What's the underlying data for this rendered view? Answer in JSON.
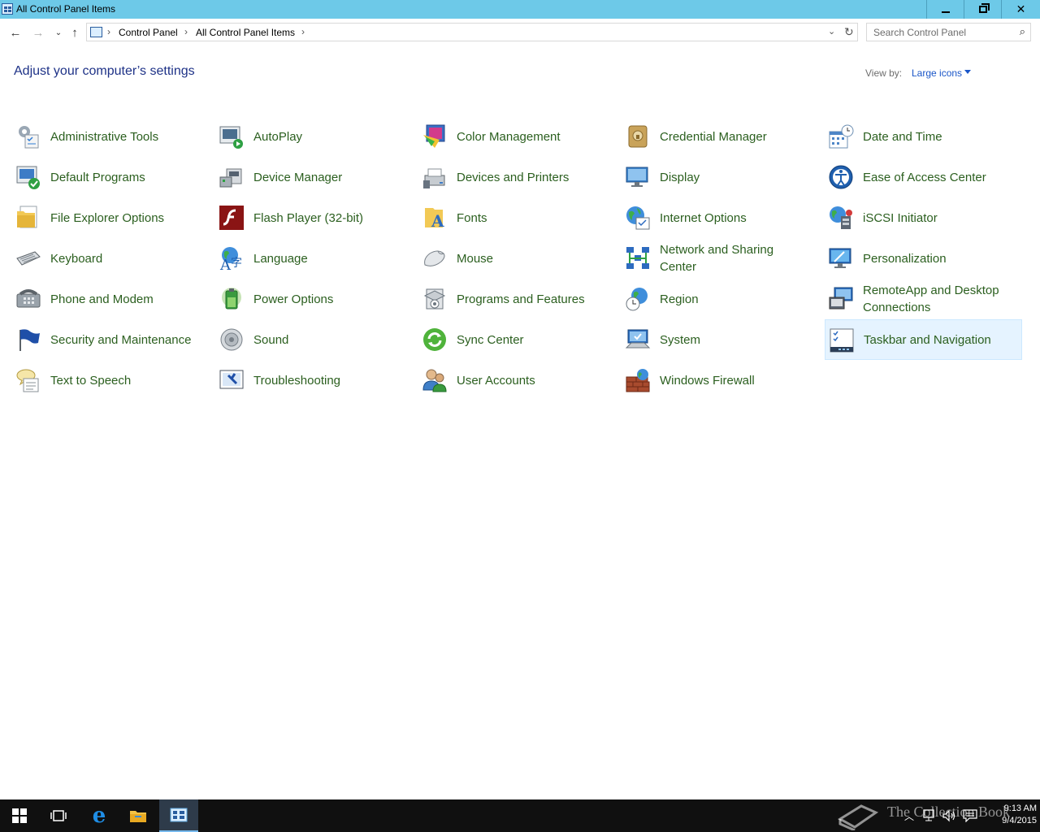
{
  "window": {
    "title": "All Control Panel Items"
  },
  "address": {
    "crumbs": [
      "Control Panel",
      "All Control Panel Items"
    ],
    "search_placeholder": "Search Control Panel"
  },
  "header": {
    "title": "Adjust your computer’s settings",
    "view_by_label": "View by:",
    "view_by_value": "Large icons"
  },
  "items": [
    {
      "label": "Administrative Tools",
      "icon": "administrative-tools-icon"
    },
    {
      "label": "AutoPlay",
      "icon": "autoplay-icon"
    },
    {
      "label": "Color Management",
      "icon": "color-management-icon"
    },
    {
      "label": "Credential Manager",
      "icon": "credential-manager-icon"
    },
    {
      "label": "Date and Time",
      "icon": "date-and-time-icon"
    },
    {
      "label": "Default Programs",
      "icon": "default-programs-icon"
    },
    {
      "label": "Device Manager",
      "icon": "device-manager-icon"
    },
    {
      "label": "Devices and Printers",
      "icon": "devices-and-printers-icon"
    },
    {
      "label": "Display",
      "icon": "display-icon"
    },
    {
      "label": "Ease of Access Center",
      "icon": "ease-of-access-icon"
    },
    {
      "label": "File Explorer Options",
      "icon": "file-explorer-options-icon"
    },
    {
      "label": "Flash Player (32-bit)",
      "icon": "flash-player-icon"
    },
    {
      "label": "Fonts",
      "icon": "fonts-icon"
    },
    {
      "label": "Internet Options",
      "icon": "internet-options-icon"
    },
    {
      "label": "iSCSI Initiator",
      "icon": "iscsi-initiator-icon"
    },
    {
      "label": "Keyboard",
      "icon": "keyboard-icon"
    },
    {
      "label": "Language",
      "icon": "language-icon"
    },
    {
      "label": "Mouse",
      "icon": "mouse-icon"
    },
    {
      "label": "Network and Sharing Center",
      "icon": "network-sharing-icon"
    },
    {
      "label": "Personalization",
      "icon": "personalization-icon"
    },
    {
      "label": "Phone and Modem",
      "icon": "phone-modem-icon"
    },
    {
      "label": "Power Options",
      "icon": "power-options-icon"
    },
    {
      "label": "Programs and Features",
      "icon": "programs-features-icon"
    },
    {
      "label": "Region",
      "icon": "region-icon"
    },
    {
      "label": "RemoteApp and Desktop Connections",
      "icon": "remoteapp-icon"
    },
    {
      "label": "Security and Maintenance",
      "icon": "security-maintenance-icon"
    },
    {
      "label": "Sound",
      "icon": "sound-icon"
    },
    {
      "label": "Sync Center",
      "icon": "sync-center-icon"
    },
    {
      "label": "System",
      "icon": "system-icon"
    },
    {
      "label": "Taskbar and Navigation",
      "icon": "taskbar-navigation-icon",
      "selected": true
    },
    {
      "label": "Text to Speech",
      "icon": "text-to-speech-icon"
    },
    {
      "label": "Troubleshooting",
      "icon": "troubleshooting-icon"
    },
    {
      "label": "User Accounts",
      "icon": "user-accounts-icon"
    },
    {
      "label": "Windows Firewall",
      "icon": "windows-firewall-icon"
    }
  ],
  "taskbar": {
    "watermark": "The Collection Book",
    "time": "9:13 AM",
    "date": "9/4/2015"
  },
  "colors": {
    "titlebar": "#6dc9e8",
    "heading": "#1e3287",
    "link": "#1a56c8",
    "selection": "#e5f3ff"
  }
}
